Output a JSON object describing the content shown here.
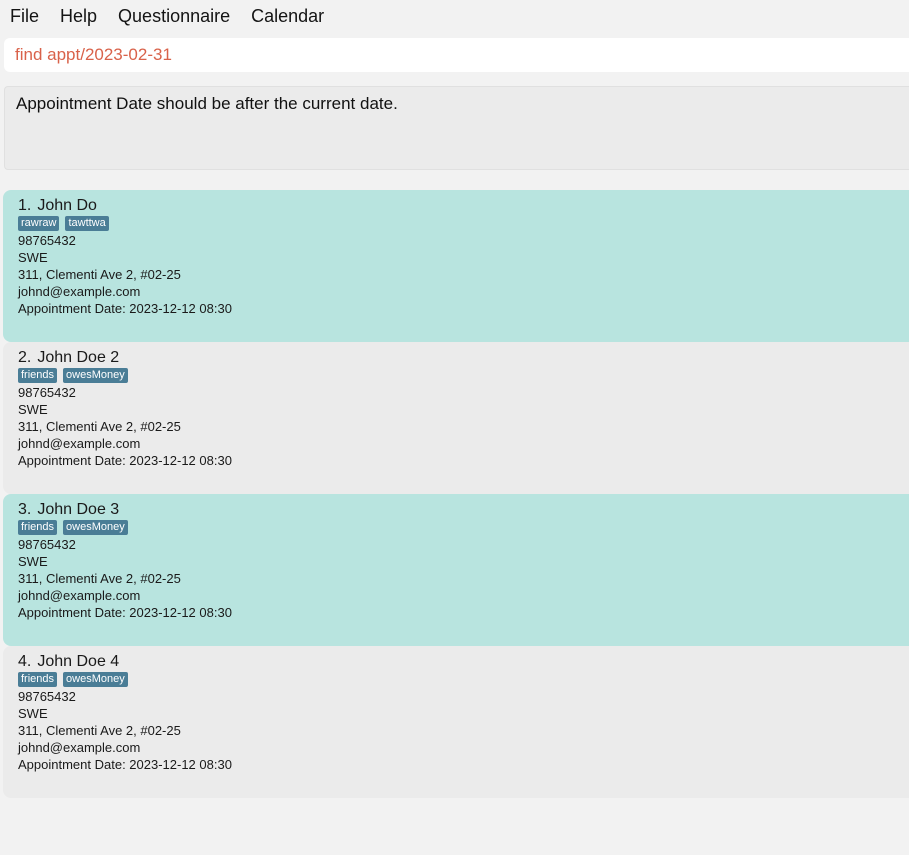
{
  "menu": [
    "File",
    "Help",
    "Questionnaire",
    "Calendar"
  ],
  "command": {
    "value": "find appt/2023-02-31"
  },
  "result": {
    "message": "Appointment Date should be after the current date."
  },
  "persons": [
    {
      "index": "1.",
      "name": "John Do",
      "tags": [
        "rawraw",
        "tawttwa"
      ],
      "phone": "98765432",
      "occupation": "SWE",
      "address": "311, Clementi Ave 2, #02-25",
      "email": "johnd@example.com",
      "appointment": "Appointment Date: 2023-12-12 08:30",
      "selected": true
    },
    {
      "index": "2.",
      "name": "John Doe 2",
      "tags": [
        "friends",
        "owesMoney"
      ],
      "phone": "98765432",
      "occupation": "SWE",
      "address": "311, Clementi Ave 2, #02-25",
      "email": "johnd@example.com",
      "appointment": "Appointment Date: 2023-12-12 08:30",
      "selected": false
    },
    {
      "index": "3.",
      "name": "John Doe 3",
      "tags": [
        "friends",
        "owesMoney"
      ],
      "phone": "98765432",
      "occupation": "SWE",
      "address": "311, Clementi Ave 2, #02-25",
      "email": "johnd@example.com",
      "appointment": "Appointment Date: 2023-12-12 08:30",
      "selected": true
    },
    {
      "index": "4.",
      "name": "John Doe 4",
      "tags": [
        "friends",
        "owesMoney"
      ],
      "phone": "98765432",
      "occupation": "SWE",
      "address": "311, Clementi Ave 2, #02-25",
      "email": "johnd@example.com",
      "appointment": "Appointment Date: 2023-12-12 08:30",
      "selected": false
    }
  ]
}
